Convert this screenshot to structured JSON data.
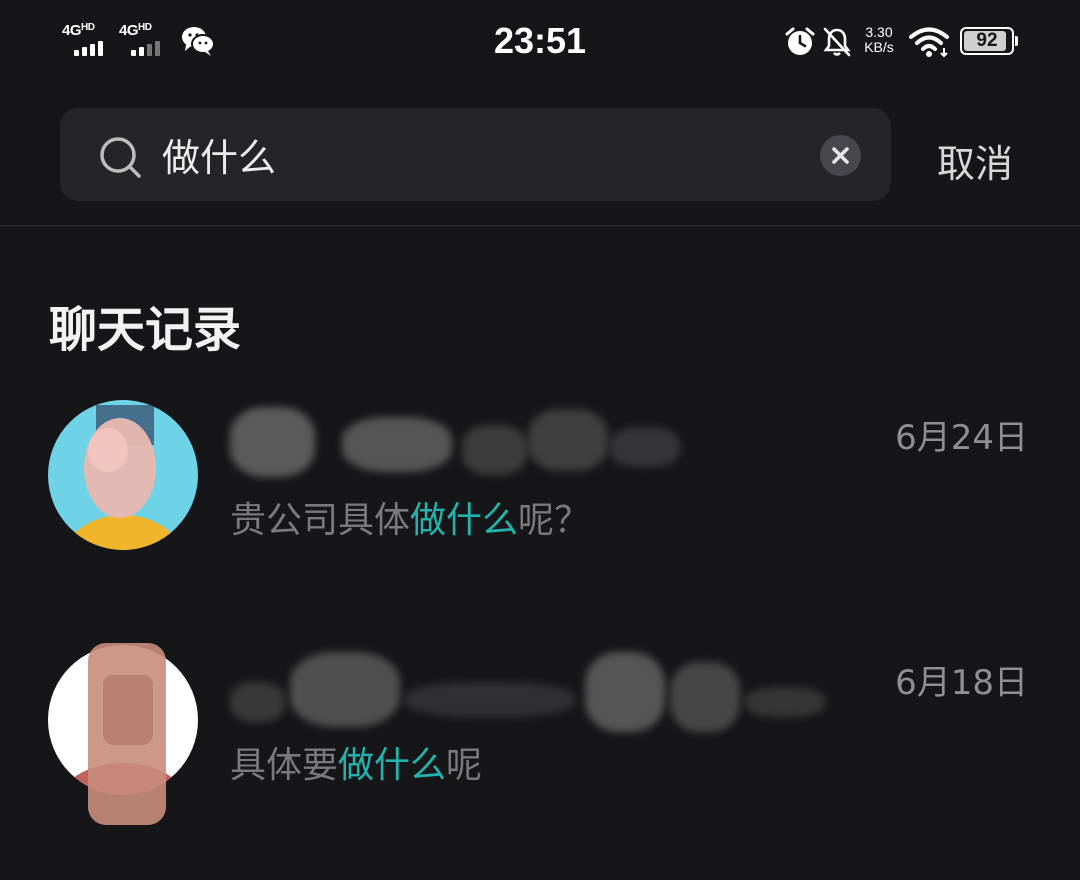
{
  "status_bar": {
    "sim1": "4G",
    "sim1_hd": "HD",
    "sim2": "4G",
    "sim2_hd": "HD",
    "time": "23:51",
    "speed_value": "3.30",
    "speed_unit": "KB/s",
    "battery": "92",
    "battery_fraction": 0.92
  },
  "search": {
    "query": "做什么",
    "cancel_label": "取消"
  },
  "section_title": "聊天记录",
  "results": [
    {
      "date": "6月24日",
      "preview_before": "贵公司具体",
      "preview_match": "做什么",
      "preview_after": "呢？",
      "avatar_colors": {
        "bg": "#6fd3e8",
        "shirt": "#f0b52a",
        "face": "#e8b8b0"
      }
    },
    {
      "date": "6月18日",
      "preview_before": "具体要",
      "preview_match": "做什么",
      "preview_after": "呢",
      "avatar_colors": {
        "bg": "#ffffff",
        "shirt": "#b33a35",
        "face": "#c98d7c"
      }
    }
  ],
  "colors": {
    "background": "#161618",
    "highlight": "#22b3ad",
    "search_bg": "#252528"
  }
}
